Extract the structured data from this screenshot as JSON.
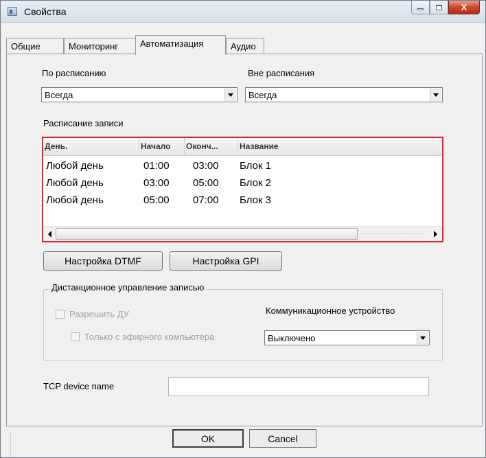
{
  "window": {
    "title": "Свойства",
    "controls": {
      "minimize": "–",
      "maximize": "□",
      "close": "X"
    }
  },
  "tabs": [
    {
      "label": "Общие",
      "active": false
    },
    {
      "label": "Мониторинг",
      "active": false
    },
    {
      "label": "Автоматизация",
      "active": true
    },
    {
      "label": "Аудио",
      "active": false
    }
  ],
  "schedule": {
    "on_label": "По расписанию",
    "on_value": "Всегда",
    "off_label": "Вне расписания",
    "off_value": "Всегда"
  },
  "recording": {
    "label": "Расписание записи",
    "columns": [
      "День.",
      "Начало",
      "Оконч...",
      "Название"
    ],
    "rows": [
      [
        "Любой день",
        "01:00",
        "03:00",
        "Блок 1"
      ],
      [
        "Любой день",
        "03:00",
        "05:00",
        "Блок 2"
      ],
      [
        "Любой день",
        "05:00",
        "07:00",
        "Блок 3"
      ]
    ]
  },
  "buttons": {
    "dtmf": "Настройка DTMF",
    "gpi": "Настройка GPI"
  },
  "remote": {
    "group_title": "Дистанционное управление записью",
    "allow_label": "Разрешить ДУ",
    "only_air_label": "Только с эфирного компьютера",
    "device_label": "Коммуникационное устройство",
    "device_value": "Выключено"
  },
  "tcp": {
    "label": "TCP device name",
    "value": ""
  },
  "footer": {
    "ok": "OK",
    "cancel": "Cancel"
  },
  "colors": {
    "table_border": "#e0202a",
    "close_button": "#c8452c"
  }
}
